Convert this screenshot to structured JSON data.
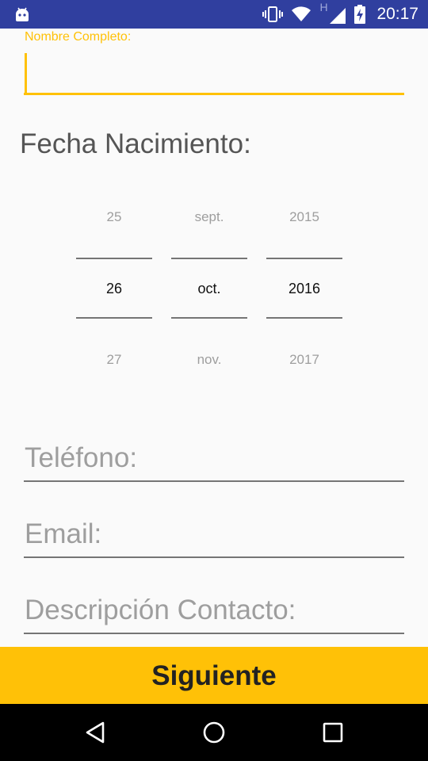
{
  "status_bar": {
    "time": "20:17",
    "network_label": "H",
    "icons": [
      "android-robot-icon",
      "vibrate-icon",
      "wifi-icon",
      "signal-icon",
      "battery-charging-icon"
    ]
  },
  "form": {
    "name_label": "Nombre Completo:",
    "name_value": "",
    "birth_title": "Fecha Nacimiento:",
    "date_picker": {
      "day": {
        "prev": "25",
        "selected": "26",
        "next": "27"
      },
      "month": {
        "prev": "sept.",
        "selected": "oct.",
        "next": "nov."
      },
      "year": {
        "prev": "2015",
        "selected": "2016",
        "next": "2017"
      }
    },
    "phone_placeholder": "Teléfono:",
    "email_placeholder": "Email:",
    "description_placeholder": "Descripción Contacto:",
    "next_button_label": "Siguiente"
  },
  "colors": {
    "status_bar": "#303f9f",
    "accent": "#ffc107",
    "background": "#fafafa",
    "nav_bar": "#000000"
  },
  "nav_bar": {
    "icons": [
      "back-icon",
      "home-icon",
      "recents-icon"
    ]
  }
}
